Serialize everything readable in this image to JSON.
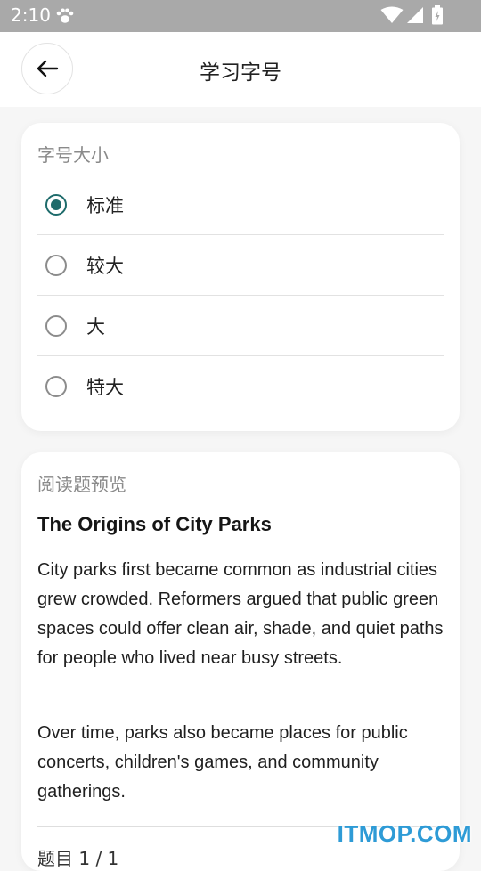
{
  "status_bar": {
    "time": "2:10",
    "icons": [
      "paw-icon",
      "wifi-icon",
      "signal-icon",
      "battery-icon"
    ]
  },
  "header": {
    "title": "学习字号",
    "back_icon": "arrow-left-icon"
  },
  "font_size_card": {
    "label": "字号大小",
    "options": [
      {
        "label": "标准",
        "selected": true
      },
      {
        "label": "较大",
        "selected": false
      },
      {
        "label": "大",
        "selected": false
      },
      {
        "label": "特大",
        "selected": false
      }
    ],
    "accent_color": "#1e6b6b"
  },
  "preview_card": {
    "label": "阅读题预览",
    "title": "The Origins of City Parks",
    "paragraph1": "City parks first became common as industrial cities grew crowded. Reformers argued that public green spaces could offer clean air, shade, and quiet paths for people who lived near busy streets.",
    "paragraph2": "Over time, parks also became places for public concerts, children's games, and community gatherings.",
    "question_count": "题目 1 / 1"
  },
  "watermark": "ITMOP.COM"
}
